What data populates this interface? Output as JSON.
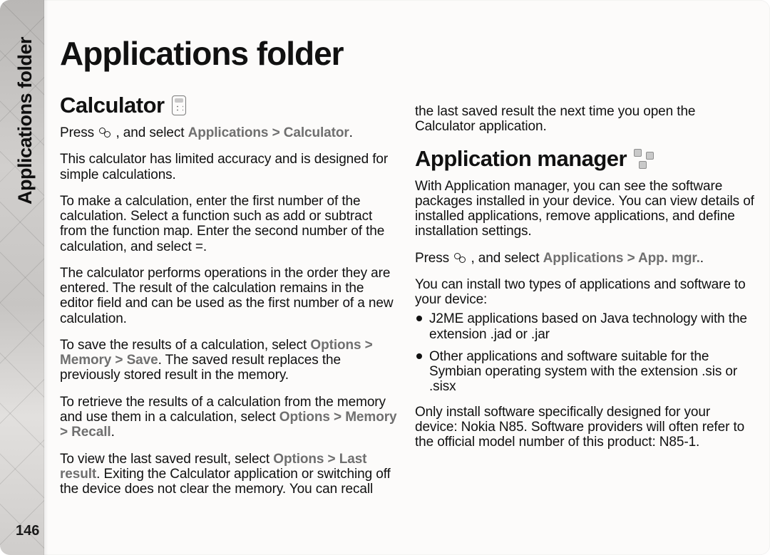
{
  "sidebar": {
    "label": "Applications folder"
  },
  "page_number": "146",
  "title": "Applications folder",
  "calc": {
    "heading": "Calculator",
    "press_prefix": "Press ",
    "press_suffix": " , and select ",
    "nav": "Applications  >  Calculator",
    "press_end": ".",
    "p_accuracy": "This calculator has limited accuracy and is designed for simple calculations.",
    "p_make": "To make a calculation, enter the first number of the calculation. Select a function such as add or subtract from the function map. Enter the second number of the calculation, and select =.",
    "p_order": "The calculator performs operations in the order they are entered. The result of the calculation remains in the editor field and can be used as the first number of a new calculation.",
    "save_prefix": "To save the results of a calculation, select ",
    "save_nav": "Options  > Memory  >  Save",
    "save_suffix": ". The saved result replaces the previously stored result in the memory.",
    "recall_prefix": "To retrieve the results of a calculation from the memory and use them in a calculation, select ",
    "recall_nav": "Options  >  Memory  >  Recall",
    "recall_end": ".",
    "last_prefix": "To view the last saved result, select ",
    "last_nav": "Options  >  Last result",
    "last_suffix": ". Exiting the Calculator application or switching off the device does not clear the memory. You can recall"
  },
  "col2": {
    "carry": "the last saved result the next time you open the Calculator application."
  },
  "appmgr": {
    "heading": "Application manager",
    "p_with": "With Application manager, you can see the software packages installed in your device. You can view details of installed applications, remove applications, and define installation settings.",
    "press_prefix": "Press ",
    "press_suffix": " , and select ",
    "nav": "Applications  >  App. mgr.",
    "press_end": ".",
    "p_two": "You can install two types of applications and software to your device:",
    "li1": "J2ME applications based on Java technology with the extension .jad or .jar",
    "li2": "Other applications and software suitable for the Symbian operating system with the extension .sis or .sisx",
    "p_only": "Only install software specifically designed for your device: Nokia N85. Software providers will often refer to the official model number of this product: N85-1."
  }
}
